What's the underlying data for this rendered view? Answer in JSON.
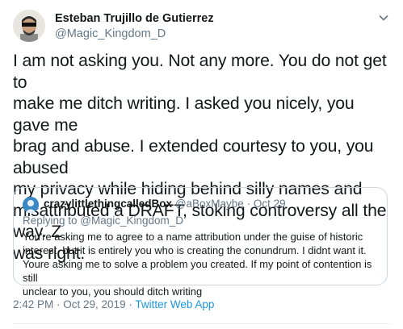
{
  "author": {
    "display_name": "Esteban Trujillo de Gutierrez",
    "handle": "@Magic_Kingdom_D"
  },
  "tweet": {
    "text": "I am not asking you. Not any more. You do not get to\nmake me ditch writing. I asked you nicely, you gave me\nbrag and abuse. I extended courtesy to you, you abused\nmy privacy while hiding behind silly names and\nmisattributed a DRAFT, stoking controversy all the way. Z\nwas right."
  },
  "quoted": {
    "display_name": "crazylittlethingcalledBox",
    "handle": "@aBoxMaybe",
    "separator": "·",
    "date": "Oct 29",
    "replying_to": "Replying to @Magic_Kingdom_D",
    "text": "You're asking me to agree to a name attribution under the guise of historic\ninterest, but it is entirely you who is creating the conundrum. I didnt want it.\nYoure asking me to solve a problem you created. If my point of contention is still\nunclear to you, you should ditch writing"
  },
  "meta": {
    "timestamp": "2:42 PM · Oct 29, 2019 · ",
    "source": "Twitter Web App"
  },
  "icons": {
    "menu": "chevron-down-icon"
  },
  "colors": {
    "text": "#14171a",
    "secondary": "#657786",
    "link": "#1b95e0",
    "border": "#ccd6dd"
  }
}
